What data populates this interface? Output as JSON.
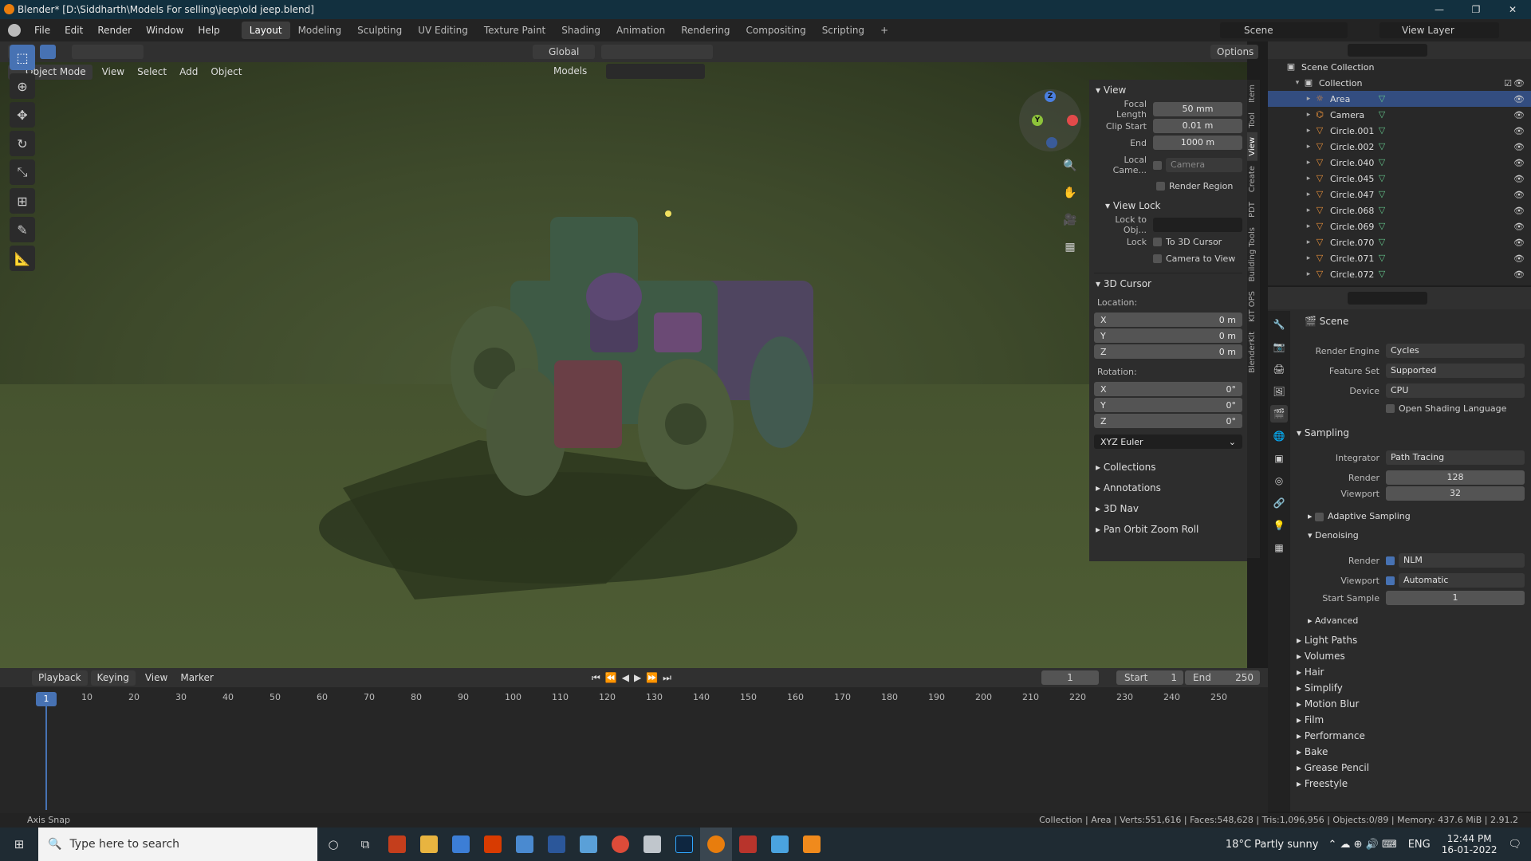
{
  "window": {
    "title": "Blender* [D:\\Siddharth\\Models For selling\\jeep\\old jeep.blend]"
  },
  "menu": [
    "File",
    "Edit",
    "Render",
    "Window",
    "Help"
  ],
  "workspaces": [
    "Layout",
    "Modeling",
    "Sculpting",
    "UV Editing",
    "Texture Paint",
    "Shading",
    "Animation",
    "Rendering",
    "Compositing",
    "Scripting",
    "+"
  ],
  "scene_name": "Scene",
  "view_layer": "View Layer",
  "header": {
    "transform_orientation": "Global",
    "options": "Options"
  },
  "viewport_header": {
    "mode": "Object Mode",
    "view": "View",
    "select": "Select",
    "add": "Add",
    "object": "Object",
    "collection_filter": "Models"
  },
  "npanel": {
    "view_title": "View",
    "focal_length_label": "Focal Length",
    "focal_length": "50 mm",
    "clip_start_label": "Clip Start",
    "clip_start": "0.01 m",
    "clip_end_label": "End",
    "clip_end": "1000 m",
    "local_camera_label": "Local Came...",
    "local_camera": "Camera",
    "render_region": "Render Region",
    "view_lock_title": "View Lock",
    "lock_to_obj_label": "Lock to Obj...",
    "lock_label": "Lock",
    "to_3d_cursor": "To 3D Cursor",
    "camera_to_view": "Camera to View",
    "cursor_title": "3D Cursor",
    "location_label": "Location:",
    "loc": [
      {
        "axis": "X",
        "val": "0 m"
      },
      {
        "axis": "Y",
        "val": "0 m"
      },
      {
        "axis": "Z",
        "val": "0 m"
      }
    ],
    "rotation_label": "Rotation:",
    "rot": [
      {
        "axis": "X",
        "val": "0°"
      },
      {
        "axis": "Y",
        "val": "0°"
      },
      {
        "axis": "Z",
        "val": "0°"
      }
    ],
    "rotation_mode": "XYZ Euler",
    "sections": [
      "Collections",
      "Annotations",
      "3D Nav",
      "Pan Orbit Zoom Roll"
    ]
  },
  "side_tabs": [
    "Item",
    "Tool",
    "View",
    "Create",
    "PDT",
    "Building Tools",
    "KIT OPS",
    "BlenderKit"
  ],
  "timeline": {
    "playback": "Playback",
    "keying": "Keying",
    "view": "View",
    "marker": "Marker",
    "current": "1",
    "start_label": "Start",
    "start": "1",
    "end_label": "End",
    "end": "250",
    "ticks": [
      "10",
      "20",
      "30",
      "40",
      "50",
      "60",
      "70",
      "80",
      "90",
      "100",
      "110",
      "120",
      "130",
      "140",
      "150",
      "160",
      "170",
      "180",
      "190",
      "200",
      "210",
      "220",
      "230",
      "240",
      "250"
    ]
  },
  "outliner": {
    "scene_collection": "Scene Collection",
    "collection": "Collection",
    "items": [
      {
        "name": "Area",
        "type": "light",
        "sel": true
      },
      {
        "name": "Camera",
        "type": "camera"
      },
      {
        "name": "Circle.001",
        "type": "mesh"
      },
      {
        "name": "Circle.002",
        "type": "mesh"
      },
      {
        "name": "Circle.040",
        "type": "mesh"
      },
      {
        "name": "Circle.045",
        "type": "mesh"
      },
      {
        "name": "Circle.047",
        "type": "mesh"
      },
      {
        "name": "Circle.068",
        "type": "mesh"
      },
      {
        "name": "Circle.069",
        "type": "mesh"
      },
      {
        "name": "Circle.070",
        "type": "mesh"
      },
      {
        "name": "Circle.071",
        "type": "mesh"
      },
      {
        "name": "Circle.072",
        "type": "mesh"
      }
    ]
  },
  "properties": {
    "context": "Scene",
    "render_engine_label": "Render Engine",
    "render_engine": "Cycles",
    "feature_set_label": "Feature Set",
    "feature_set": "Supported",
    "device_label": "Device",
    "device": "CPU",
    "osl": "Open Shading Language",
    "sampling": "Sampling",
    "integrator_label": "Integrator",
    "integrator": "Path Tracing",
    "render_label": "Render",
    "render_samples": "128",
    "viewport_label": "Viewport",
    "viewport_samples": "32",
    "adaptive": "Adaptive Sampling",
    "denoising": "Denoising",
    "den_render": "NLM",
    "den_viewport": "Automatic",
    "start_sample_label": "Start Sample",
    "start_sample": "1",
    "advanced": "Advanced",
    "sections": [
      "Light Paths",
      "Volumes",
      "Hair",
      "Simplify",
      "Motion Blur",
      "Film",
      "Performance",
      "Bake",
      "Grease Pencil",
      "Freestyle"
    ]
  },
  "status": {
    "left": "Axis Snap",
    "right": "Collection | Area | Verts:551,616 | Faces:548,628 | Tris:1,096,956 | Objects:0/89 | Memory: 437.6 MiB | 2.91.2"
  },
  "taskbar": {
    "search": "Type here to search",
    "weather": "18°C  Partly sunny",
    "lang": "ENG",
    "time": "12:44 PM",
    "date": "16-01-2022"
  },
  "colors": {
    "accent": "#4772b3",
    "mesh_icon": "#e8903a",
    "data_icon": "#63c48a"
  }
}
